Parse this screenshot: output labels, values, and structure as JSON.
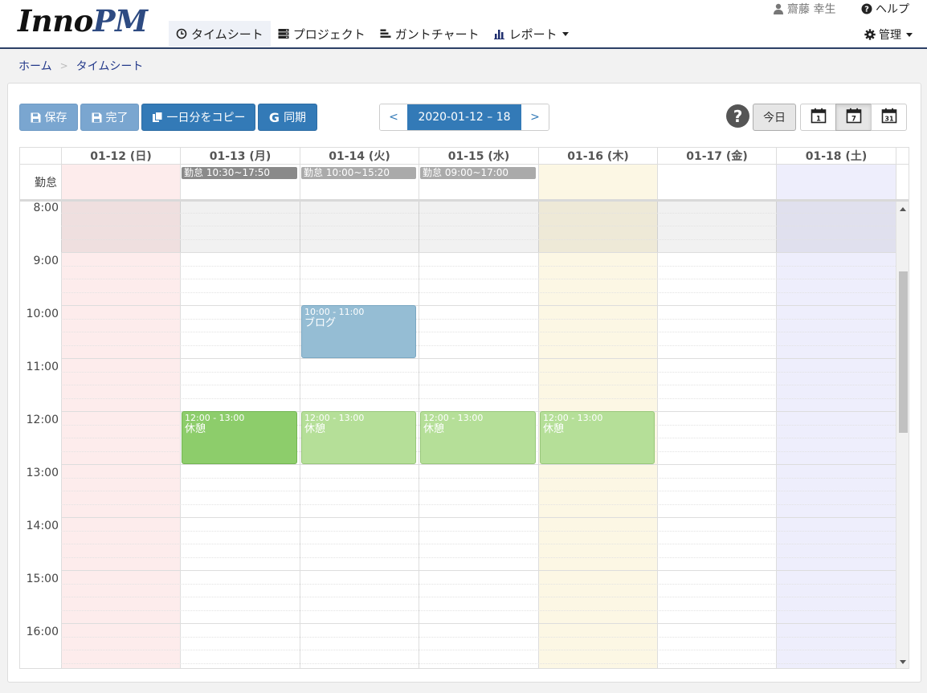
{
  "logo": {
    "part1": "Inno",
    "part2": "PM"
  },
  "nav": [
    {
      "label": "タイムシート",
      "icon": "clock-icon",
      "active": true
    },
    {
      "label": "プロジェクト",
      "icon": "server-icon",
      "active": false
    },
    {
      "label": "ガントチャート",
      "icon": "gantt-icon",
      "active": false
    },
    {
      "label": "レポート",
      "icon": "bar-chart-icon",
      "active": false,
      "dropdown": true
    }
  ],
  "header": {
    "user_name": "齋藤 幸生",
    "help_label": "ヘルプ",
    "admin_label": "管理"
  },
  "breadcrumb": {
    "home": "ホーム",
    "separator": ">",
    "current": "タイムシート"
  },
  "toolbar": {
    "save_label": "保存",
    "done_label": "完了",
    "copy_day_label": "一日分をコピー",
    "sync_label": "同期",
    "prev": "<",
    "next": ">",
    "date_range": "2020-01-12 – 18",
    "help_mark": "?",
    "today_label": "今日",
    "view_day_num": "1",
    "view_week_num": "7",
    "view_month_num": "31",
    "active_view": "week"
  },
  "calendar": {
    "allday_label": "勤怠",
    "days": [
      {
        "label": "01-12 (日)",
        "bg": "#fdecec"
      },
      {
        "label": "01-13 (月)",
        "bg": "#ffffff"
      },
      {
        "label": "01-14 (火)",
        "bg": "#ffffff"
      },
      {
        "label": "01-15 (水)",
        "bg": "#ffffff"
      },
      {
        "label": "01-16 (木)",
        "bg": "#fcf7e4"
      },
      {
        "label": "01-17 (金)",
        "bg": "#ffffff"
      },
      {
        "label": "01-18 (土)",
        "bg": "#eeeefc"
      }
    ],
    "attendance": [
      {
        "day": 1,
        "label": "勤怠 10:30~17:50",
        "color": "#8a8a8a"
      },
      {
        "day": 2,
        "label": "勤怠 10:00~15:20",
        "color": "#aaaaaa"
      },
      {
        "day": 3,
        "label": "勤怠 09:00~17:00",
        "color": "#aaaaaa"
      }
    ],
    "hours": [
      "8:00",
      "9:00",
      "10:00",
      "11:00",
      "12:00",
      "13:00",
      "14:00",
      "15:00",
      "16:00"
    ],
    "first_hour": 8,
    "non_business_until": 9,
    "events": [
      {
        "day": 2,
        "start": 10,
        "end": 11,
        "time": "10:00 - 11:00",
        "title": "ブログ",
        "color": "#95bdd4",
        "border": "#7aa7c2"
      },
      {
        "day": 1,
        "start": 12,
        "end": 13,
        "time": "12:00 - 13:00",
        "title": "休憩",
        "color": "#8dcd6b",
        "border": "#72b552"
      },
      {
        "day": 2,
        "start": 12,
        "end": 13,
        "time": "12:00 - 13:00",
        "title": "休憩",
        "color": "#b5df98",
        "border": "#98c77a"
      },
      {
        "day": 3,
        "start": 12,
        "end": 13,
        "time": "12:00 - 13:00",
        "title": "休憩",
        "color": "#b5df98",
        "border": "#98c77a"
      },
      {
        "day": 4,
        "start": 12,
        "end": 13,
        "time": "12:00 - 13:00",
        "title": "休憩",
        "color": "#b5df98",
        "border": "#98c77a"
      }
    ]
  },
  "colors": {
    "primary": "#337ab7",
    "primary_light": "#7aa6d0",
    "brand_dark": "#2b3f66"
  }
}
